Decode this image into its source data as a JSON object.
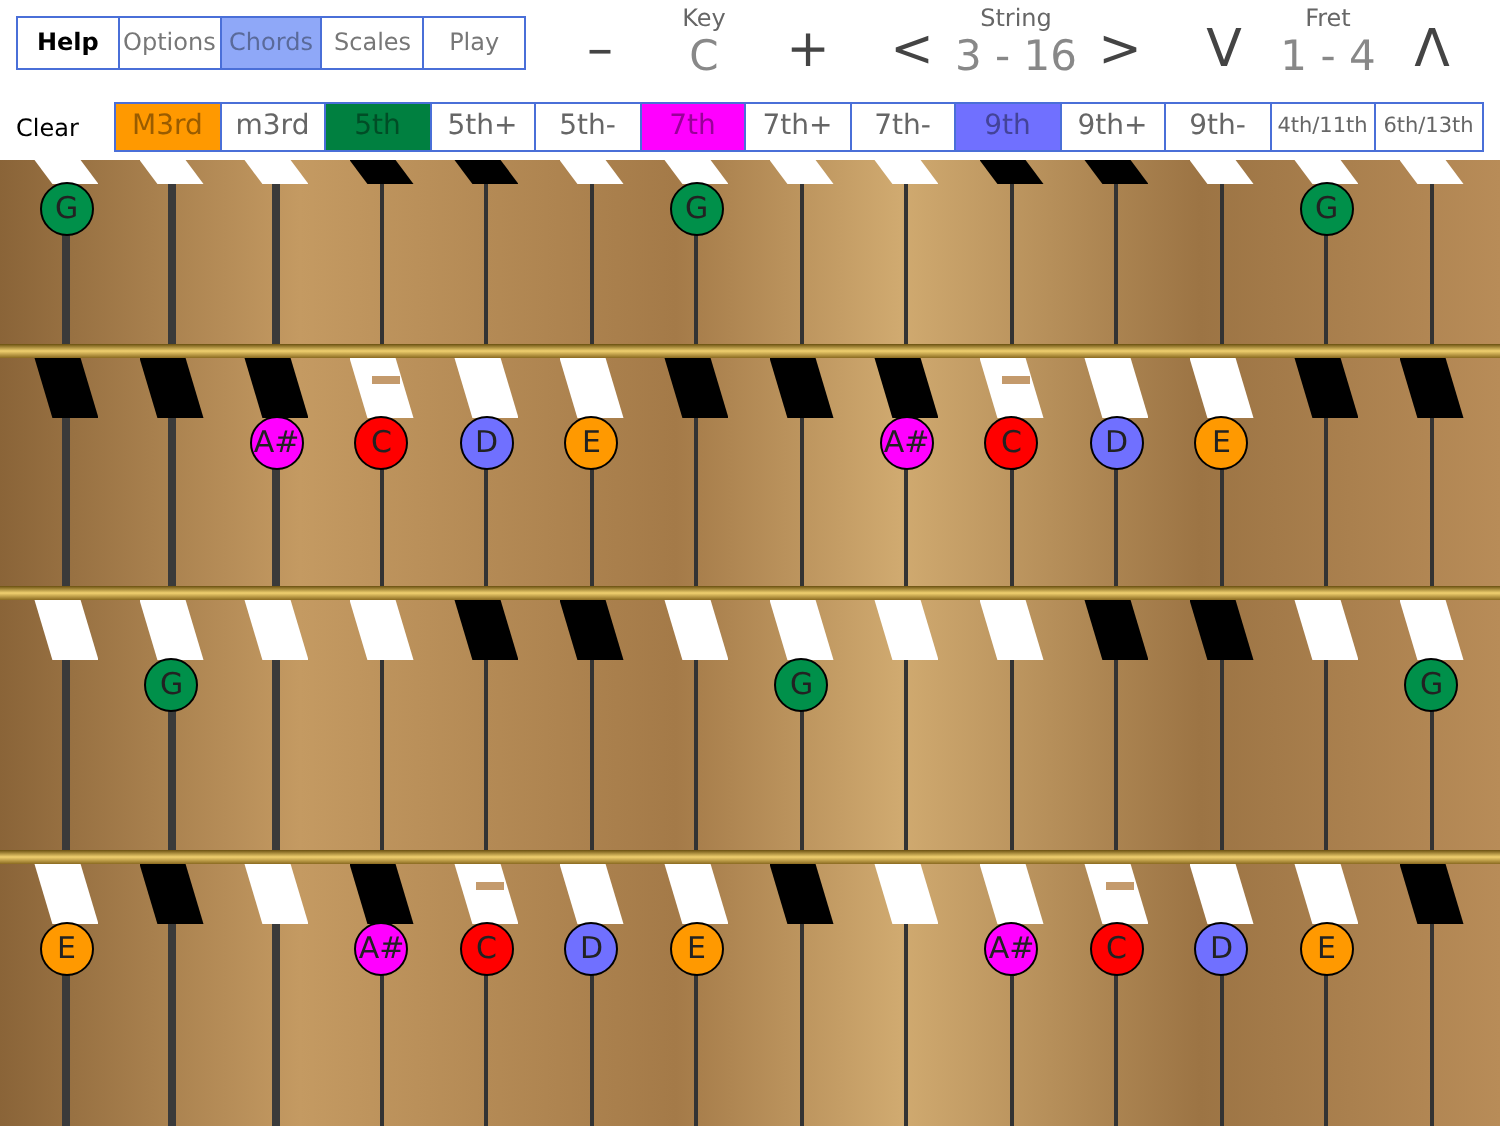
{
  "tabs": [
    {
      "label": "Help",
      "kind": "help",
      "selected": false
    },
    {
      "label": "Options",
      "kind": "mode",
      "selected": false
    },
    {
      "label": "Chords",
      "kind": "mode",
      "selected": true
    },
    {
      "label": "Scales",
      "kind": "mode",
      "selected": false
    },
    {
      "label": "Play",
      "kind": "mode",
      "selected": false
    }
  ],
  "key": {
    "label": "Key",
    "value": "C",
    "decrease": "–",
    "increase": "+"
  },
  "string": {
    "label": "String",
    "value": "3 - 16",
    "previous": "<",
    "next": ">"
  },
  "fret": {
    "label": "Fret",
    "value": "1 - 4",
    "down": "V",
    "up": "Λ"
  },
  "clear": "Clear",
  "intervals": [
    {
      "label": "M3rd",
      "active": true,
      "color": "#ff9900"
    },
    {
      "label": "m3rd",
      "active": false
    },
    {
      "label": "5th",
      "active": true,
      "color": "#008040"
    },
    {
      "label": "5th+",
      "active": false
    },
    {
      "label": "5th-",
      "active": false
    },
    {
      "label": "7th",
      "active": true,
      "color": "#ff00ff"
    },
    {
      "label": "7th+",
      "active": false
    },
    {
      "label": "7th-",
      "active": false
    },
    {
      "label": "9th",
      "active": true,
      "color": "#7070ff"
    },
    {
      "label": "9th+",
      "active": false
    },
    {
      "label": "9th-",
      "active": false
    },
    {
      "label": "4th/11th",
      "active": false
    },
    {
      "label": "6th/13th",
      "active": false
    }
  ],
  "fret_rows": [
    {
      "kind": "top",
      "strings": [
        {
          "kind": "natural",
          "note": "G",
          "color": "#00904a"
        },
        {
          "kind": "natural"
        },
        {
          "kind": "natural"
        },
        {
          "kind": "sharp"
        },
        {
          "kind": "sharp"
        },
        {
          "kind": "natural"
        },
        {
          "kind": "natural",
          "note": "G",
          "color": "#00904a"
        },
        {
          "kind": "natural"
        },
        {
          "kind": "natural"
        },
        {
          "kind": "sharp"
        },
        {
          "kind": "sharp"
        },
        {
          "kind": "natural"
        },
        {
          "kind": "natural",
          "note": "G",
          "color": "#00904a"
        },
        {
          "kind": "natural"
        }
      ]
    },
    {
      "kind": "fret",
      "strings": [
        {
          "kind": "sharp"
        },
        {
          "kind": "sharp"
        },
        {
          "kind": "sharp",
          "note": "A#",
          "color": "#ff00ff"
        },
        {
          "kind": "dotted",
          "note": "C",
          "color": "#ff0000"
        },
        {
          "kind": "natural",
          "note": "D",
          "color": "#7070ff"
        },
        {
          "kind": "natural",
          "note": "E",
          "color": "#ff9900"
        },
        {
          "kind": "sharp"
        },
        {
          "kind": "sharp"
        },
        {
          "kind": "sharp",
          "note": "A#",
          "color": "#ff00ff"
        },
        {
          "kind": "dotted",
          "note": "C",
          "color": "#ff0000"
        },
        {
          "kind": "natural",
          "note": "D",
          "color": "#7070ff"
        },
        {
          "kind": "natural",
          "note": "E",
          "color": "#ff9900"
        },
        {
          "kind": "sharp"
        },
        {
          "kind": "sharp"
        }
      ]
    },
    {
      "kind": "fret",
      "strings": [
        {
          "kind": "natural"
        },
        {
          "kind": "natural",
          "note": "G",
          "color": "#00904a"
        },
        {
          "kind": "natural"
        },
        {
          "kind": "natural"
        },
        {
          "kind": "sharp"
        },
        {
          "kind": "sharp"
        },
        {
          "kind": "natural"
        },
        {
          "kind": "natural",
          "note": "G",
          "color": "#00904a"
        },
        {
          "kind": "natural"
        },
        {
          "kind": "natural"
        },
        {
          "kind": "sharp"
        },
        {
          "kind": "sharp"
        },
        {
          "kind": "natural"
        },
        {
          "kind": "natural",
          "note": "G",
          "color": "#00904a"
        }
      ]
    },
    {
      "kind": "fret",
      "strings": [
        {
          "kind": "natural",
          "note": "E",
          "color": "#ff9900"
        },
        {
          "kind": "sharp"
        },
        {
          "kind": "natural"
        },
        {
          "kind": "sharp",
          "note": "A#",
          "color": "#ff00ff"
        },
        {
          "kind": "dotted",
          "note": "C",
          "color": "#ff0000"
        },
        {
          "kind": "natural",
          "note": "D",
          "color": "#7070ff"
        },
        {
          "kind": "natural",
          "note": "E",
          "color": "#ff9900"
        },
        {
          "kind": "sharp"
        },
        {
          "kind": "natural"
        },
        {
          "kind": "natural",
          "note": "A#",
          "color": "#ff00ff"
        },
        {
          "kind": "dotted",
          "note": "C",
          "color": "#ff0000"
        },
        {
          "kind": "natural",
          "note": "D",
          "color": "#7070ff"
        },
        {
          "kind": "natural",
          "note": "E",
          "color": "#ff9900"
        },
        {
          "kind": "sharp"
        }
      ]
    }
  ]
}
